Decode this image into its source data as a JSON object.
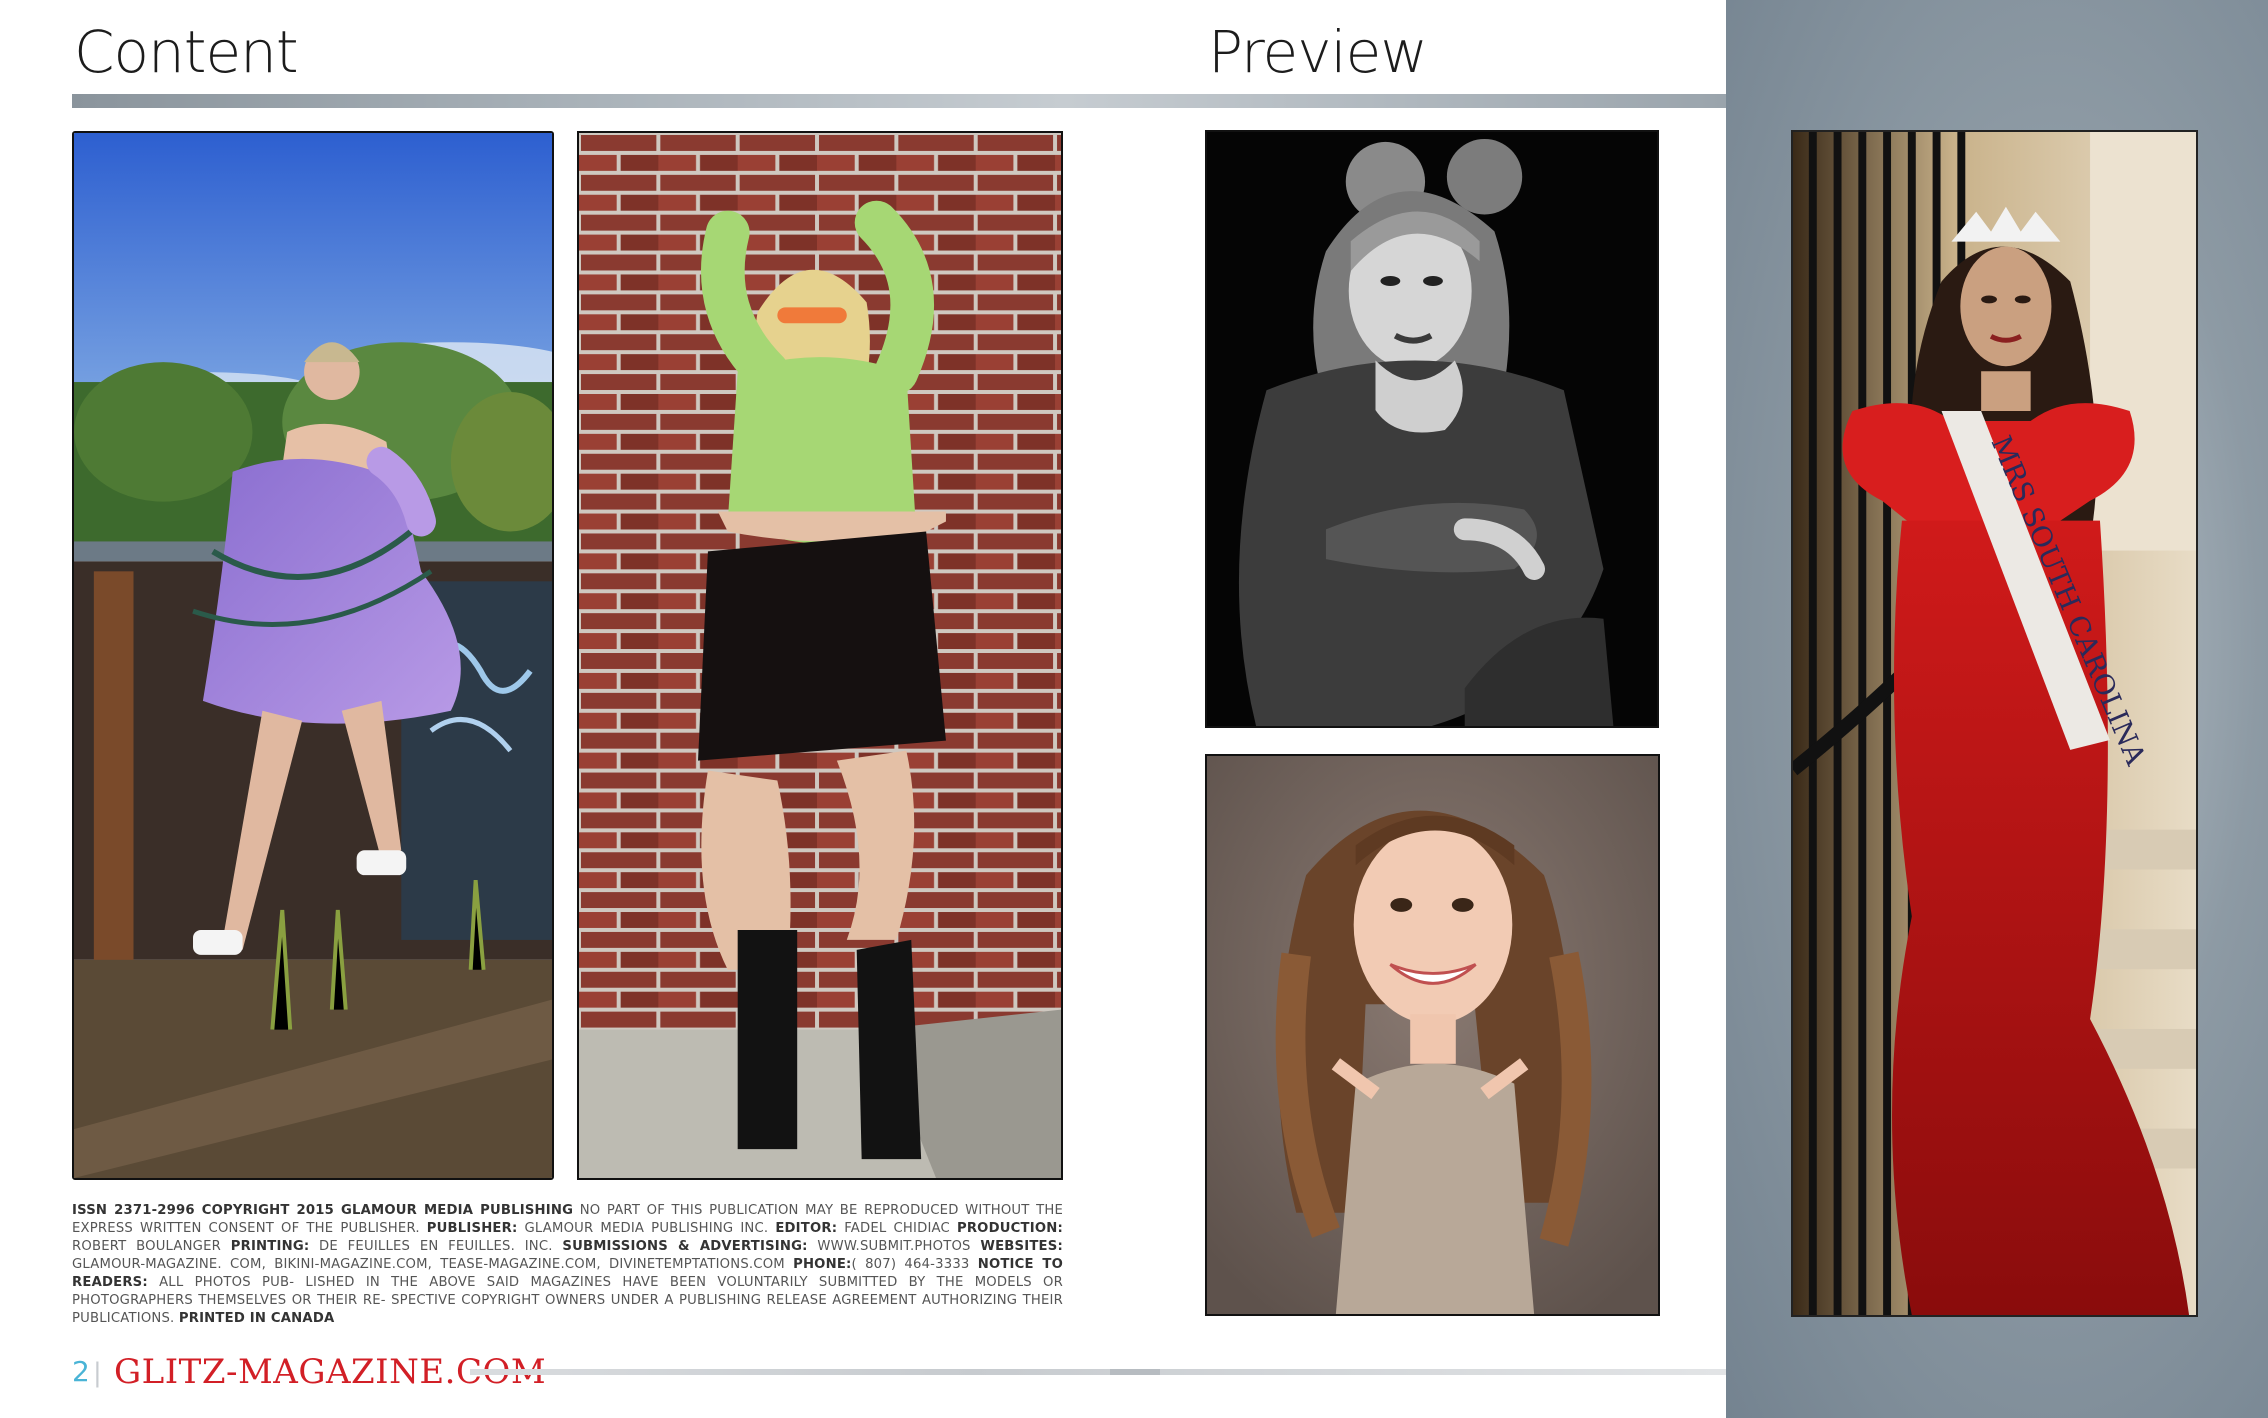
{
  "headings": {
    "content": "Content",
    "preview": "Preview"
  },
  "photos": [
    {
      "name": "photo-woman-purple-dress"
    },
    {
      "name": "photo-woman-green-shirt-brick-wall"
    },
    {
      "name": "photo-woman-black-and-white-portrait"
    },
    {
      "name": "photo-girl-smiling-portrait"
    },
    {
      "name": "photo-woman-red-gown-sash",
      "sash_text": "MRS SOUTH CAROLINA"
    }
  ],
  "credits": {
    "issn": "ISSN 2371-2996 COPYRIGHT 2015 GLAMOUR MEDIA PUBLISHING",
    "issn_text": "NO PART OF THIS PUBLICATION MAY BE REPRODUCED WITHOUT THE EXPRESS WRITTEN CONSENT OF THE PUBLISHER.",
    "publisher_label": "PUBLISHER:",
    "publisher_value": "GLAMOUR MEDIA PUBLISHING INC.",
    "editor_label": "EDITOR:",
    "editor_value": "FADEL CHIDIAC",
    "production_label": "PRODUCTION:",
    "production_value": "ROBERT BOULANGER",
    "printing_label": "PRINTING:",
    "printing_value": "DE FEUILLES EN FEUILLES. INC.",
    "submissions_label": "SUBMISSIONS & ADVERTISING:",
    "submissions_value": "WWW.SUBMIT.PHOTOS",
    "websites_label": "WEBSITES:",
    "websites_value": "GLAMOUR-MAGAZINE. COM, BIKINI-MAGAZINE.COM, TEASE-MAGAZINE.COM, DIVINETEMPTATIONS.COM",
    "phone_label": "PHONE:",
    "phone_value": "( 807) 464-3333",
    "notice_label": "NOTICE TO READERS:",
    "notice_value": "ALL PHOTOS PUB- LISHED IN THE ABOVE SAID MAGAZINES HAVE BEEN VOLUNTARILY SUBMITTED BY THE MODELS OR PHOTOGRAPHERS THEMSELVES OR THEIR RE- SPECTIVE COPYRIGHT OWNERS UNDER A PUBLISHING RELEASE AGREEMENT AUTHORIZING THEIR PUBLICATIONS.",
    "printed": "PRINTED IN CANADA"
  },
  "footer": {
    "page_number": "2",
    "separator": "|",
    "brand": "GLITZ-MAGAZINE.COM"
  },
  "colors": {
    "accent_blue": "#4ab4d6",
    "brand_red": "#d21f26",
    "right_panel": "#8d9aa4"
  }
}
